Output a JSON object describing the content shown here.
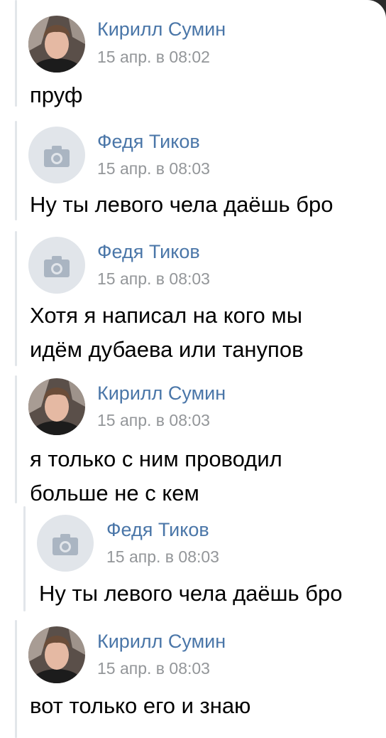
{
  "messages": [
    {
      "author": "Кирилл Сумин",
      "time": "15 апр. в 08:02",
      "avatar": "user-photo",
      "lines": [
        "пруф"
      ]
    },
    {
      "author": "Федя Тиков",
      "time": "15 апр. в 08:03",
      "avatar": "camera-placeholder",
      "lines": [
        "Ну ты левого чела даёшь бро"
      ]
    },
    {
      "author": "Федя Тиков",
      "time": "15 апр. в 08:03",
      "avatar": "camera-placeholder",
      "lines": [
        "Хотя я написал на кого мы",
        "идём дубаева или танупов"
      ]
    },
    {
      "author": "Кирилл Сумин",
      "time": "15 апр. в 08:03",
      "avatar": "user-photo",
      "lines": [
        "я только с ним проводил",
        "больше не с кем"
      ]
    }
  ],
  "quoted": {
    "author": "Федя Тиков",
    "time": "15 апр. в 08:03",
    "avatar": "camera-placeholder",
    "lines": [
      "Ну ты левого чела даёшь бро"
    ]
  },
  "last_message": {
    "author": "Кирилл Сумин",
    "time": "15 апр. в 08:03",
    "avatar": "user-photo",
    "lines": [
      "вот только его и знаю"
    ]
  },
  "colors": {
    "author": "#4a76a8",
    "time": "#939699",
    "bar": "#e2e6ea",
    "placeholder_bg": "#e1e5ea",
    "camera": "#aab5c2"
  }
}
